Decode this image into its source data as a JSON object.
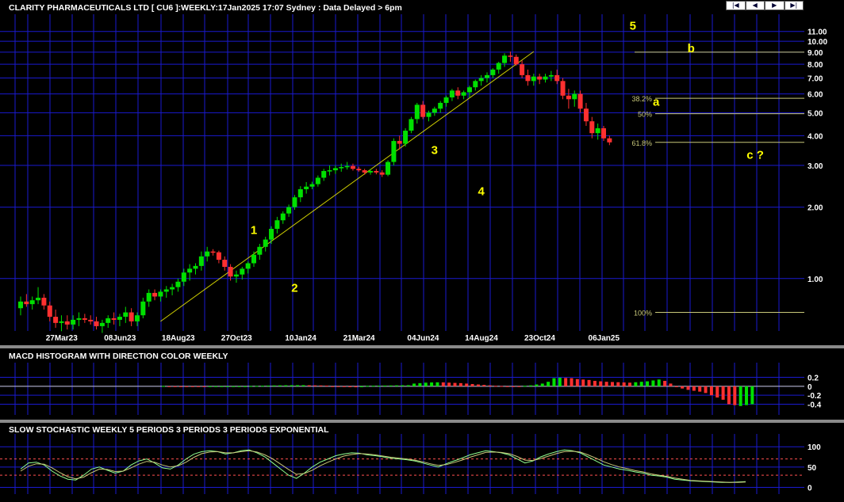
{
  "colors": {
    "background": "#000000",
    "grid": "#1a1ad0",
    "up": "#00e000",
    "down": "#ff3030",
    "text": "#ffffff",
    "wave": "#ffff00",
    "fib": "#c8c87a",
    "stochK": "#90ff90",
    "stochD": "#c8c87a"
  },
  "nav": [
    {
      "label": "|◀",
      "icon": "first-icon"
    },
    {
      "label": "◀",
      "icon": "prev-icon"
    },
    {
      "label": "▶",
      "icon": "next-icon"
    },
    {
      "label": "▶|",
      "icon": "last-icon"
    }
  ],
  "chart_data": [
    {
      "type": "candlestick",
      "title": "CLARITY PHARMACEUTICALS LTD [ CU6 ]:WEEKLY:17Jan2025 17:07 Sydney : Data Delayed > 6pm",
      "scale": "log",
      "ylim": [
        0.62,
        13.0
      ],
      "y_ticks": [
        "11.00",
        "10.00",
        "9.00",
        "8.00",
        "7.00",
        "6.00",
        "5.00",
        "4.00",
        "3.00",
        "2.00",
        "1.00"
      ],
      "y_tick_values": [
        11,
        10,
        9,
        8,
        7,
        6,
        5,
        4,
        3,
        2,
        1
      ],
      "x_ticks": [
        {
          "index": 5,
          "label": "27Mar23"
        },
        {
          "index": 15,
          "label": "08Jun23"
        },
        {
          "index": 25,
          "label": "18Aug23"
        },
        {
          "index": 35,
          "label": "27Oct23"
        },
        {
          "index": 46,
          "label": "10Jan24"
        },
        {
          "index": 56,
          "label": "21Mar24"
        },
        {
          "index": 67,
          "label": "04Jun24"
        },
        {
          "index": 77,
          "label": "14Aug24"
        },
        {
          "index": 87,
          "label": "23Oct24"
        },
        {
          "index": 98,
          "label": "06Jan25"
        }
      ],
      "candles": [
        [
          0.75,
          0.84,
          0.7,
          0.8
        ],
        [
          0.8,
          0.86,
          0.76,
          0.78
        ],
        [
          0.78,
          0.84,
          0.74,
          0.81
        ],
        [
          0.81,
          0.92,
          0.78,
          0.83
        ],
        [
          0.83,
          0.86,
          0.74,
          0.77
        ],
        [
          0.77,
          0.8,
          0.66,
          0.69
        ],
        [
          0.69,
          0.74,
          0.62,
          0.65
        ],
        [
          0.65,
          0.7,
          0.6,
          0.66
        ],
        [
          0.66,
          0.7,
          0.61,
          0.64
        ],
        [
          0.64,
          0.7,
          0.61,
          0.67
        ],
        [
          0.67,
          0.72,
          0.63,
          0.68
        ],
        [
          0.68,
          0.71,
          0.65,
          0.67
        ],
        [
          0.67,
          0.7,
          0.64,
          0.66
        ],
        [
          0.66,
          0.69,
          0.61,
          0.63
        ],
        [
          0.63,
          0.67,
          0.59,
          0.65
        ],
        [
          0.65,
          0.7,
          0.62,
          0.68
        ],
        [
          0.68,
          0.72,
          0.64,
          0.67
        ],
        [
          0.67,
          0.71,
          0.63,
          0.69
        ],
        [
          0.69,
          0.76,
          0.65,
          0.72
        ],
        [
          0.72,
          0.75,
          0.63,
          0.66
        ],
        [
          0.66,
          0.72,
          0.63,
          0.7
        ],
        [
          0.7,
          0.83,
          0.68,
          0.8
        ],
        [
          0.8,
          0.9,
          0.76,
          0.87
        ],
        [
          0.87,
          0.9,
          0.81,
          0.84
        ],
        [
          0.84,
          0.9,
          0.8,
          0.88
        ],
        [
          0.88,
          0.93,
          0.83,
          0.9
        ],
        [
          0.9,
          0.95,
          0.85,
          0.92
        ],
        [
          0.92,
          1.0,
          0.88,
          0.97
        ],
        [
          0.97,
          1.1,
          0.93,
          1.06
        ],
        [
          1.06,
          1.15,
          0.98,
          1.1
        ],
        [
          1.1,
          1.16,
          1.04,
          1.13
        ],
        [
          1.13,
          1.3,
          1.08,
          1.24
        ],
        [
          1.24,
          1.36,
          1.18,
          1.3
        ],
        [
          1.3,
          1.33,
          1.25,
          1.29
        ],
        [
          1.29,
          1.31,
          1.16,
          1.2
        ],
        [
          1.2,
          1.24,
          1.08,
          1.12
        ],
        [
          1.12,
          1.15,
          0.98,
          1.02
        ],
        [
          1.02,
          1.08,
          0.96,
          1.04
        ],
        [
          1.04,
          1.12,
          0.99,
          1.1
        ],
        [
          1.1,
          1.18,
          1.05,
          1.16
        ],
        [
          1.16,
          1.3,
          1.12,
          1.26
        ],
        [
          1.26,
          1.4,
          1.2,
          1.36
        ],
        [
          1.36,
          1.5,
          1.3,
          1.46
        ],
        [
          1.46,
          1.66,
          1.4,
          1.62
        ],
        [
          1.62,
          1.82,
          1.55,
          1.76
        ],
        [
          1.76,
          1.92,
          1.7,
          1.88
        ],
        [
          1.88,
          2.05,
          1.82,
          2.0
        ],
        [
          2.0,
          2.25,
          1.95,
          2.2
        ],
        [
          2.2,
          2.45,
          2.1,
          2.38
        ],
        [
          2.38,
          2.55,
          2.28,
          2.44
        ],
        [
          2.44,
          2.56,
          2.38,
          2.5
        ],
        [
          2.5,
          2.72,
          2.44,
          2.66
        ],
        [
          2.66,
          2.9,
          2.58,
          2.84
        ],
        [
          2.84,
          3.0,
          2.72,
          2.86
        ],
        [
          2.86,
          3.0,
          2.76,
          2.92
        ],
        [
          2.92,
          3.05,
          2.82,
          2.95
        ],
        [
          2.95,
          3.1,
          2.88,
          2.98
        ],
        [
          2.98,
          3.05,
          2.85,
          2.9
        ],
        [
          2.9,
          2.96,
          2.82,
          2.86
        ],
        [
          2.86,
          2.9,
          2.74,
          2.8
        ],
        [
          2.8,
          2.9,
          2.74,
          2.84
        ],
        [
          2.84,
          2.9,
          2.75,
          2.8
        ],
        [
          2.8,
          2.86,
          2.68,
          2.74
        ],
        [
          2.74,
          3.15,
          2.7,
          3.1
        ],
        [
          3.1,
          3.9,
          3.0,
          3.8
        ],
        [
          3.8,
          4.0,
          3.5,
          3.7
        ],
        [
          3.7,
          4.3,
          3.6,
          4.2
        ],
        [
          4.2,
          4.8,
          4.1,
          4.7
        ],
        [
          4.7,
          5.5,
          4.5,
          5.4
        ],
        [
          5.4,
          5.6,
          4.7,
          4.8
        ],
        [
          4.8,
          5.1,
          4.6,
          5.0
        ],
        [
          5.0,
          5.3,
          4.85,
          5.2
        ],
        [
          5.2,
          5.6,
          5.0,
          5.5
        ],
        [
          5.5,
          5.9,
          5.3,
          5.8
        ],
        [
          5.8,
          6.3,
          5.6,
          6.2
        ],
        [
          6.2,
          6.4,
          5.7,
          5.9
        ],
        [
          5.9,
          6.2,
          5.7,
          6.1
        ],
        [
          6.1,
          6.5,
          5.8,
          6.4
        ],
        [
          6.4,
          6.9,
          6.2,
          6.8
        ],
        [
          6.8,
          7.2,
          6.5,
          7.0
        ],
        [
          7.0,
          7.4,
          6.7,
          7.2
        ],
        [
          7.2,
          7.7,
          7.0,
          7.6
        ],
        [
          7.6,
          8.2,
          7.3,
          8.1
        ],
        [
          8.1,
          8.9,
          7.8,
          8.7
        ],
        [
          8.7,
          9.05,
          8.2,
          8.6
        ],
        [
          8.6,
          8.8,
          7.9,
          8.0
        ],
        [
          8.0,
          8.3,
          7.0,
          7.2
        ],
        [
          7.2,
          7.6,
          6.5,
          6.8
        ],
        [
          6.8,
          7.3,
          6.5,
          7.1
        ],
        [
          7.1,
          7.3,
          6.6,
          6.9
        ],
        [
          6.9,
          7.3,
          6.7,
          7.1
        ],
        [
          7.1,
          7.5,
          6.8,
          7.2
        ],
        [
          7.2,
          7.6,
          6.6,
          6.8
        ],
        [
          6.8,
          7.0,
          5.7,
          5.9
        ],
        [
          5.9,
          6.3,
          5.2,
          5.7
        ],
        [
          5.7,
          6.2,
          5.3,
          6.0
        ],
        [
          6.0,
          6.2,
          5.0,
          5.2
        ],
        [
          5.2,
          5.5,
          4.4,
          4.6
        ],
        [
          4.6,
          4.8,
          3.9,
          4.1
        ],
        [
          4.1,
          4.5,
          3.85,
          4.3
        ],
        [
          4.3,
          4.4,
          3.8,
          3.9
        ],
        [
          3.9,
          4.0,
          3.65,
          3.75
        ]
      ],
      "trendline": [
        {
          "x": 24,
          "y": 0.66
        },
        {
          "x": 88,
          "y": 9.05
        }
      ],
      "fib_levels": [
        {
          "label": "38.2%",
          "value": 5.75
        },
        {
          "label": "50%",
          "value": 4.95
        },
        {
          "label": "61.8%",
          "value": 3.75
        },
        {
          "label": "100%",
          "value": 0.72
        }
      ],
      "fib_top": 9.0,
      "wave_labels": [
        {
          "label": "1",
          "x": 40,
          "y": 1.54
        },
        {
          "label": "2",
          "x": 47,
          "y": 0.88
        },
        {
          "label": "3",
          "x": 71,
          "y": 3.35
        },
        {
          "label": "4",
          "x": 79,
          "y": 2.25
        },
        {
          "label": "5",
          "x": 105,
          "y": 11.2
        },
        {
          "label": "a",
          "x": 109,
          "y": 5.35
        },
        {
          "label": "b",
          "x": 115,
          "y": 9.0
        },
        {
          "label": "c ?",
          "x": 126,
          "y": 3.2
        }
      ]
    },
    {
      "type": "bar",
      "title": "MACD HISTOGRAM WITH DIRECTION COLOR WEEKLY",
      "ylim": [
        -0.55,
        0.35
      ],
      "y_ticks": [
        "0.2",
        "0",
        "-0.2",
        "-0.4"
      ],
      "y_tick_values": [
        0.2,
        0,
        -0.2,
        -0.4
      ],
      "values": [
        0.005,
        -0.005,
        -0.008,
        -0.01,
        -0.012,
        -0.015,
        -0.017,
        -0.018,
        -0.016,
        -0.014,
        -0.012,
        -0.01,
        -0.008,
        -0.006,
        -0.004,
        0.004,
        0.008,
        0.012,
        0.016,
        0.018,
        0.02,
        0.022,
        0.023,
        0.024,
        0.024,
        0.022,
        0.02,
        0.018,
        0.015,
        -0.01,
        -0.015,
        -0.018,
        -0.02,
        -0.022,
        -0.021,
        0.01,
        0.012,
        0.014,
        0.016,
        0.018,
        0.02,
        0.022,
        0.024,
        0.06,
        0.07,
        0.08,
        0.085,
        0.088,
        0.086,
        0.08,
        0.075,
        0.07,
        0.06,
        0.05,
        0.04,
        0.03,
        0.02,
        0.01,
        0.005,
        -0.005,
        -0.01,
        -0.012,
        0.01,
        0.02,
        0.04,
        0.06,
        0.1,
        0.18,
        0.19,
        0.185,
        0.18,
        0.16,
        0.15,
        0.14,
        0.12,
        0.11,
        0.1,
        0.095,
        0.09,
        0.085,
        0.08,
        0.09,
        0.1,
        0.11,
        0.13,
        0.15,
        0.12,
        0.06,
        -0.02,
        -0.05,
        -0.08,
        -0.1,
        -0.12,
        -0.15,
        -0.2,
        -0.25,
        -0.3,
        -0.4,
        -0.42,
        -0.44,
        -0.42,
        -0.4
      ],
      "colors": [
        "up",
        "down",
        "down",
        "down",
        "down",
        "down",
        "down",
        "down",
        "up",
        "up",
        "up",
        "up",
        "up",
        "up",
        "up",
        "up",
        "up",
        "up",
        "up",
        "up",
        "up",
        "up",
        "up",
        "up",
        "up",
        "down",
        "down",
        "down",
        "down",
        "down",
        "down",
        "down",
        "down",
        "down",
        "up",
        "up",
        "up",
        "up",
        "up",
        "up",
        "up",
        "up",
        "up",
        "up",
        "up",
        "up",
        "up",
        "up",
        "down",
        "down",
        "down",
        "down",
        "down",
        "down",
        "down",
        "down",
        "down",
        "down",
        "down",
        "down",
        "down",
        "down",
        "up",
        "up",
        "up",
        "up",
        "up",
        "up",
        "up",
        "down",
        "down",
        "down",
        "down",
        "down",
        "down",
        "down",
        "down",
        "down",
        "down",
        "down",
        "down",
        "up",
        "up",
        "up",
        "up",
        "up",
        "down",
        "down",
        "down",
        "down",
        "down",
        "down",
        "down",
        "down",
        "down",
        "down",
        "down",
        "down",
        "down",
        "up",
        "up",
        "up"
      ]
    },
    {
      "type": "line",
      "title": "SLOW STOCHASTIC WEEKLY 5 PERIODS 3 PERIODS 3 PERIODS EXPONENTIAL",
      "ylim": [
        -5,
        118
      ],
      "y_ticks": [
        "100",
        "50",
        "0"
      ],
      "y_tick_values": [
        100,
        50,
        0
      ],
      "ref_lines": [
        70,
        30
      ],
      "series": [
        {
          "role": "k",
          "values": [
            45,
            60,
            62,
            55,
            40,
            28,
            20,
            18,
            30,
            45,
            50,
            42,
            35,
            40,
            55,
            65,
            70,
            60,
            48,
            45,
            55,
            70,
            82,
            88,
            90,
            88,
            82,
            85,
            90,
            92,
            85,
            75,
            60,
            45,
            30,
            22,
            35,
            50,
            62,
            70,
            78,
            82,
            85,
            84,
            80,
            78,
            75,
            72,
            70,
            68,
            65,
            60,
            55,
            50,
            58,
            65,
            72,
            80,
            85,
            90,
            88,
            85,
            80,
            70,
            60,
            65,
            75,
            82,
            88,
            92,
            90,
            85,
            75,
            65,
            55,
            50,
            45,
            42,
            38,
            35,
            30,
            28,
            25,
            20,
            18,
            16,
            15,
            14,
            13,
            12,
            12,
            13,
            14
          ]
        },
        {
          "role": "d",
          "values": [
            40,
            52,
            58,
            57,
            48,
            36,
            26,
            21,
            25,
            36,
            45,
            44,
            39,
            40,
            48,
            57,
            64,
            62,
            55,
            50,
            53,
            62,
            74,
            83,
            87,
            88,
            85,
            85,
            88,
            90,
            87,
            80,
            70,
            57,
            44,
            32,
            34,
            42,
            53,
            62,
            70,
            77,
            81,
            83,
            82,
            80,
            77,
            74,
            72,
            70,
            67,
            63,
            58,
            54,
            56,
            61,
            67,
            74,
            80,
            86,
            87,
            86,
            83,
            76,
            67,
            66,
            71,
            77,
            83,
            88,
            89,
            87,
            80,
            72,
            63,
            56,
            50,
            46,
            41,
            38,
            33,
            30,
            27,
            23,
            20,
            17,
            16,
            15,
            14,
            13,
            12,
            12,
            13
          ]
        }
      ]
    }
  ]
}
